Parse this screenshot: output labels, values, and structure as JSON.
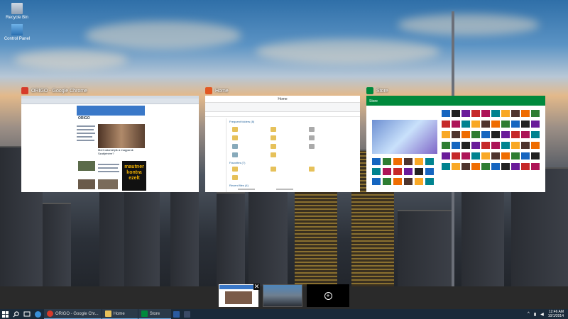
{
  "desktop": {
    "icons": [
      {
        "label": "Recycle Bin",
        "icon": "recycle-bin-icon"
      },
      {
        "label": "Control Panel",
        "icon": "control-panel-icon"
      }
    ]
  },
  "windows": [
    {
      "title": "ORIGO - Google Chrome",
      "icon": "chrome-icon",
      "accent": "#d63b2a",
      "content": {
        "logo": "ORIGO",
        "headline": "Mert valamelyik a magyarok Szabjénére?",
        "ad": "mautner kontra ezelt"
      }
    },
    {
      "title": "Home",
      "icon": "file-explorer-icon",
      "accent": "#e25822",
      "content": {
        "window_title": "Home",
        "section_frequent": "Frequent folders (8)",
        "section_favorites": "Favorites (7)",
        "section_recent": "Recent files (4)"
      }
    },
    {
      "title": "Store",
      "icon": "store-icon",
      "accent": "#00893c",
      "content": {
        "store_name": "Store"
      }
    }
  ],
  "task_view": {
    "close_symbol": "✕",
    "add_desktop_symbol": "+"
  },
  "taskbar": {
    "apps": [
      {
        "label": "ORIGO - Google Chr...",
        "icon": "chrome-icon"
      },
      {
        "label": "Home",
        "icon": "file-explorer-icon"
      },
      {
        "label": "Store",
        "icon": "store-icon"
      }
    ],
    "tray": {
      "time": "12:46 AM",
      "date": "10/1/2014"
    }
  },
  "colors": {
    "taskbar": "#1a2a3a",
    "strip": "#2a2a2a",
    "store": "#00893c"
  }
}
